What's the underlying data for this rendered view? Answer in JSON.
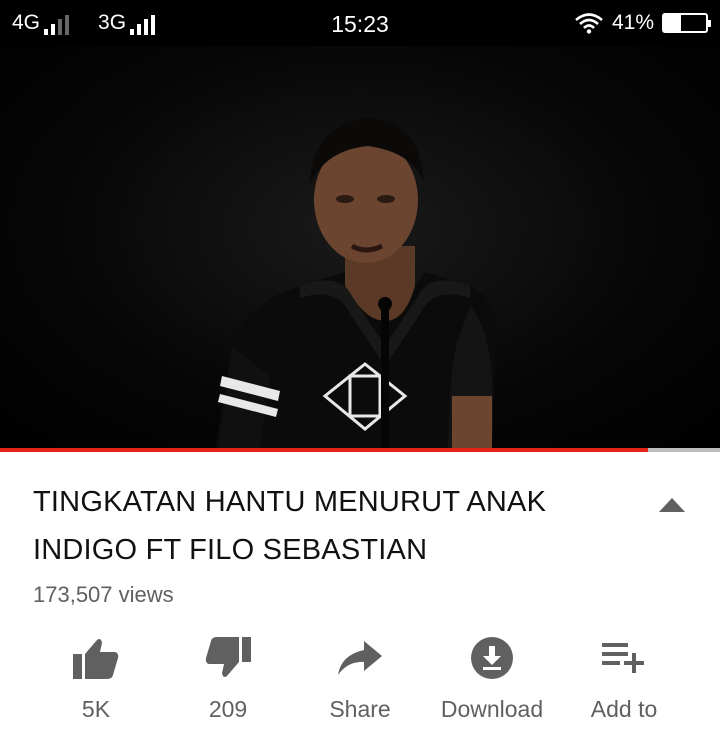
{
  "status_bar": {
    "network1": "4G",
    "network2": "3G",
    "time": "15:23",
    "battery_percent": "41%",
    "battery_level": 0.41
  },
  "video": {
    "progress": 0.9,
    "progress_color": "#e62117"
  },
  "info": {
    "title": "TINGKATAN HANTU MENURUT ANAK INDIGO FT FILO SEBASTIAN",
    "views": "173,507 views"
  },
  "actions": [
    {
      "icon": "thumbs-up-icon",
      "label": "5K"
    },
    {
      "icon": "thumbs-down-icon",
      "label": "209"
    },
    {
      "icon": "share-icon",
      "label": "Share"
    },
    {
      "icon": "download-icon",
      "label": "Download"
    },
    {
      "icon": "add-to-playlist-icon",
      "label": "Add to"
    }
  ]
}
